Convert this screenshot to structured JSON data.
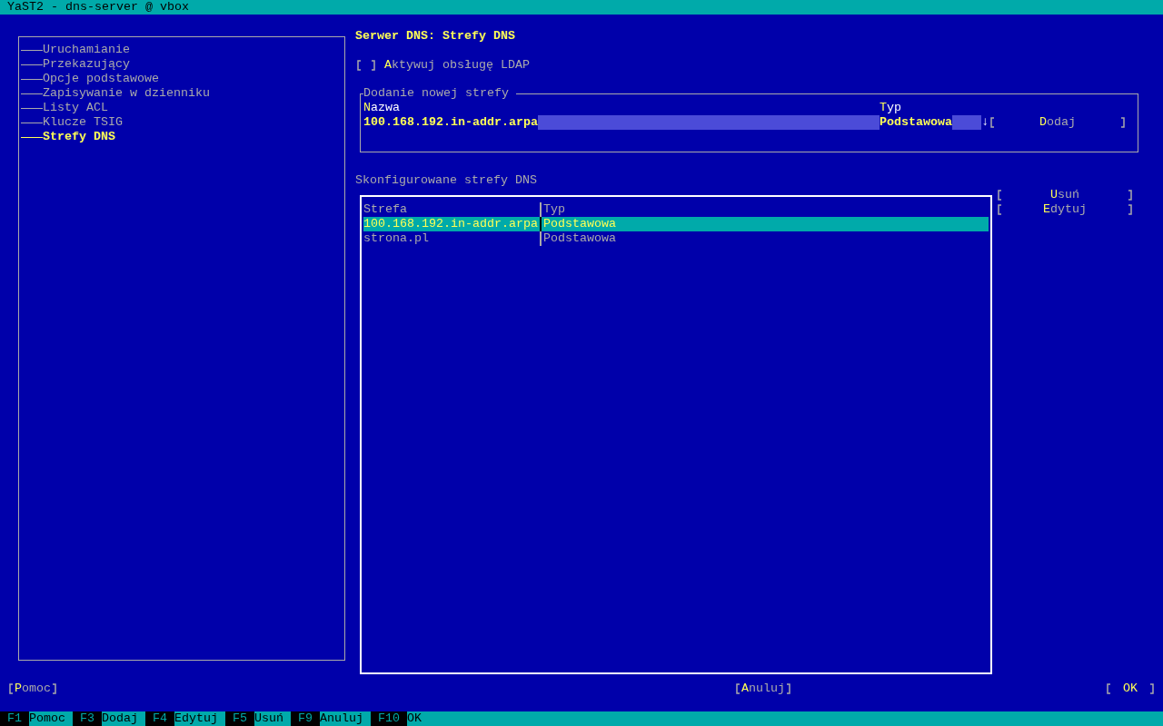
{
  "window": {
    "title": "YaST2 - dns-server @ vbox"
  },
  "sidebar": {
    "items": [
      {
        "label": "Uruchamianie",
        "selected": false
      },
      {
        "label": "Przekazujący",
        "selected": false
      },
      {
        "label": "Opcje podstawowe",
        "selected": false
      },
      {
        "label": "Zapisywanie w dzienniku",
        "selected": false
      },
      {
        "label": "Listy ACL",
        "selected": false
      },
      {
        "label": "Klucze TSIG",
        "selected": false
      },
      {
        "label": "Strefy DNS",
        "selected": true
      }
    ]
  },
  "heading": "Serwer DNS: Strefy DNS",
  "ldap_checkbox": {
    "label": "Aktywuj obsługę LDAP",
    "checked": false
  },
  "add_zone": {
    "title": "Dodanie nowej strefy",
    "name_label": "Nazwa",
    "name_value": "100.168.192.in-addr.arpa",
    "type_label": "Typ",
    "type_value": "Podstawowa",
    "arrow": "↓",
    "button": "Dodaj"
  },
  "zones": {
    "title": "Skonfigurowane strefy DNS",
    "columns": [
      "Strefa",
      "Typ"
    ],
    "rows": [
      {
        "cells": [
          "100.168.192.in-addr.arpa",
          "Podstawowa"
        ],
        "selected": true
      },
      {
        "cells": [
          "strona.pl",
          "Podstawowa"
        ],
        "selected": false
      }
    ]
  },
  "side_buttons": [
    "Usuń",
    "Edytuj"
  ],
  "buttons": {
    "help": "Pomoc",
    "cancel": "Anuluj",
    "ok": "OK"
  },
  "function_keys": [
    {
      "key": "F1",
      "label": "Pomoc"
    },
    {
      "key": "F3",
      "label": "Dodaj"
    },
    {
      "key": "F4",
      "label": "Edytuj"
    },
    {
      "key": "F5",
      "label": "Usuń"
    },
    {
      "key": "F9",
      "label": "Anuluj"
    },
    {
      "key": "F10",
      "label": "OK"
    }
  ]
}
